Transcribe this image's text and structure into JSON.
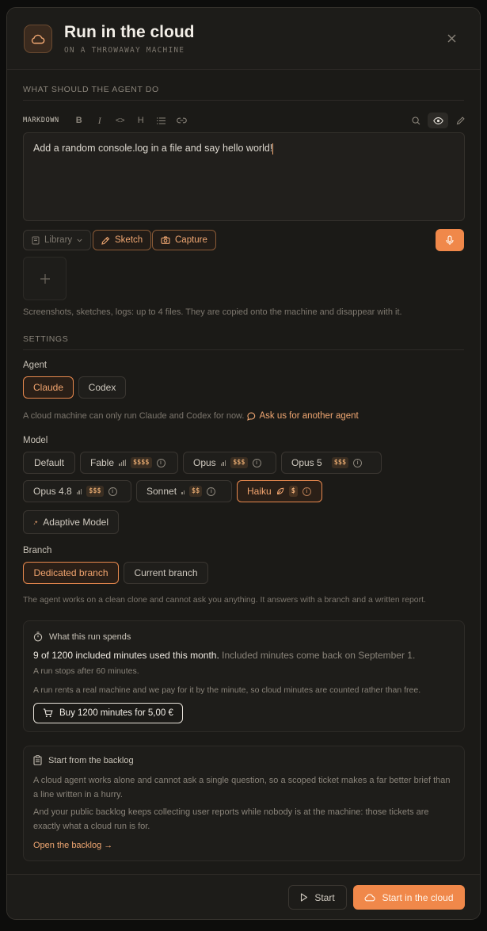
{
  "header": {
    "title": "Run in the cloud",
    "subtitle": "ON A THROWAWAY MACHINE",
    "icon": "cloud-icon",
    "close_icon": "close-icon"
  },
  "task": {
    "section_label": "WHAT SHOULD THE AGENT DO",
    "mode_label": "MARKDOWN",
    "format_buttons": [
      "B",
      "I",
      "<>",
      "H"
    ],
    "prompt_value": "Add a random console.log in a file and say hello world!"
  },
  "attachments": {
    "library_label": "Library",
    "sketch_label": "Sketch",
    "capture_label": "Capture",
    "helper": "Screenshots, sketches, logs: up to 4 files. They are copied onto the machine and disappear with it."
  },
  "settings": {
    "section_label": "SETTINGS",
    "agent": {
      "label": "Agent",
      "options": [
        "Claude",
        "Codex"
      ],
      "selected": "Claude",
      "note": "A cloud machine can only run Claude and Codex for now.",
      "link": "Ask us for another agent"
    },
    "model": {
      "label": "Model",
      "options": [
        {
          "name": "Default",
          "price": ""
        },
        {
          "name": "Fable",
          "price": "$$$$"
        },
        {
          "name": "Opus",
          "price": "$$$"
        },
        {
          "name": "Opus 5",
          "price": "$$$"
        },
        {
          "name": "Opus 4.8",
          "price": "$$$"
        },
        {
          "name": "Sonnet",
          "price": "$$"
        },
        {
          "name": "Haiku",
          "price": "$"
        }
      ],
      "selected": "Haiku",
      "adaptive_label": "Adaptive Model"
    },
    "branch": {
      "label": "Branch",
      "options": [
        "Dedicated branch",
        "Current branch"
      ],
      "selected": "Dedicated branch",
      "note": "The agent works on a clean clone and cannot ask you anything. It answers with a branch and a written report."
    }
  },
  "spend": {
    "title": "What this run spends",
    "usage_strong": "9 of 1200 included minutes used this month.",
    "usage_rest": "Included minutes come back on September 1.",
    "stop_note": "A run stops after 60 minutes.",
    "explain": "A run rents a real machine and we pay for it by the minute, so cloud minutes are counted rather than free.",
    "buy_label": "Buy 1200 minutes for 5,00 €"
  },
  "backlog": {
    "title": "Start from the backlog",
    "para1": "A cloud agent works alone and cannot ask a single question, so a scoped ticket makes a far better brief than a line written in a hurry.",
    "para2": "And your public backlog keeps collecting user reports while nobody is at the machine: those tickets are exactly what a cloud run is for.",
    "link": "Open the backlog →"
  },
  "footer": {
    "start_label": "Start",
    "cloud_label": "Start in the cloud"
  },
  "colors": {
    "accent": "#f0884a",
    "accent_text": "#f0a772",
    "background": "#1b1a17",
    "border": "#34312c"
  }
}
